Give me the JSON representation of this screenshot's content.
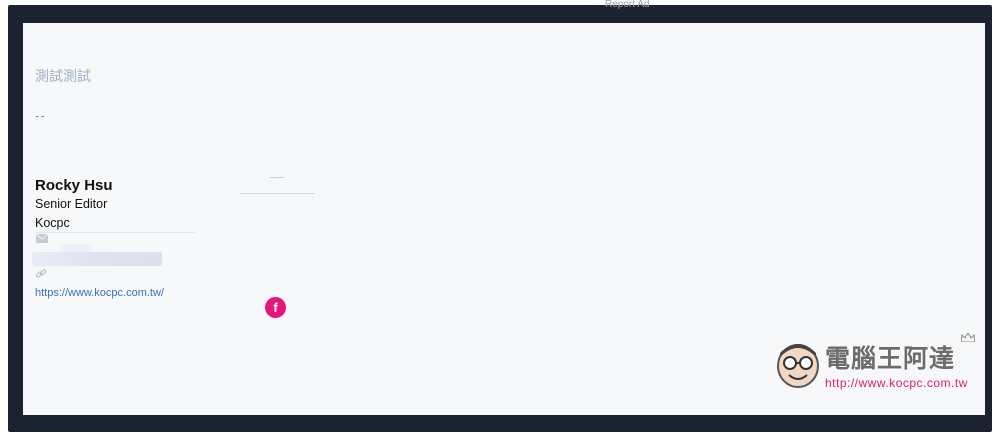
{
  "ad": {
    "report_label": "Report Ad"
  },
  "signature": {
    "title": "測試測試",
    "separator": "--",
    "name": "Rocky Hsu",
    "role": "Senior Editor",
    "company": "Kocpc",
    "url": "https://www.kocpc.com.tw/",
    "icons": {
      "email": "mail-icon",
      "link": "link-icon",
      "social": "facebook-icon"
    }
  },
  "social": {
    "facebook_glyph": "f"
  },
  "watermark": {
    "site_name": "電腦王阿達",
    "site_url": "http://www.kocpc.com.tw"
  },
  "colors": {
    "frame": "#1b2230",
    "canvas": "#f7f8fa",
    "link": "#3b6dc4",
    "facebook": "#e6157a",
    "watermark_url": "#e01c6a"
  }
}
